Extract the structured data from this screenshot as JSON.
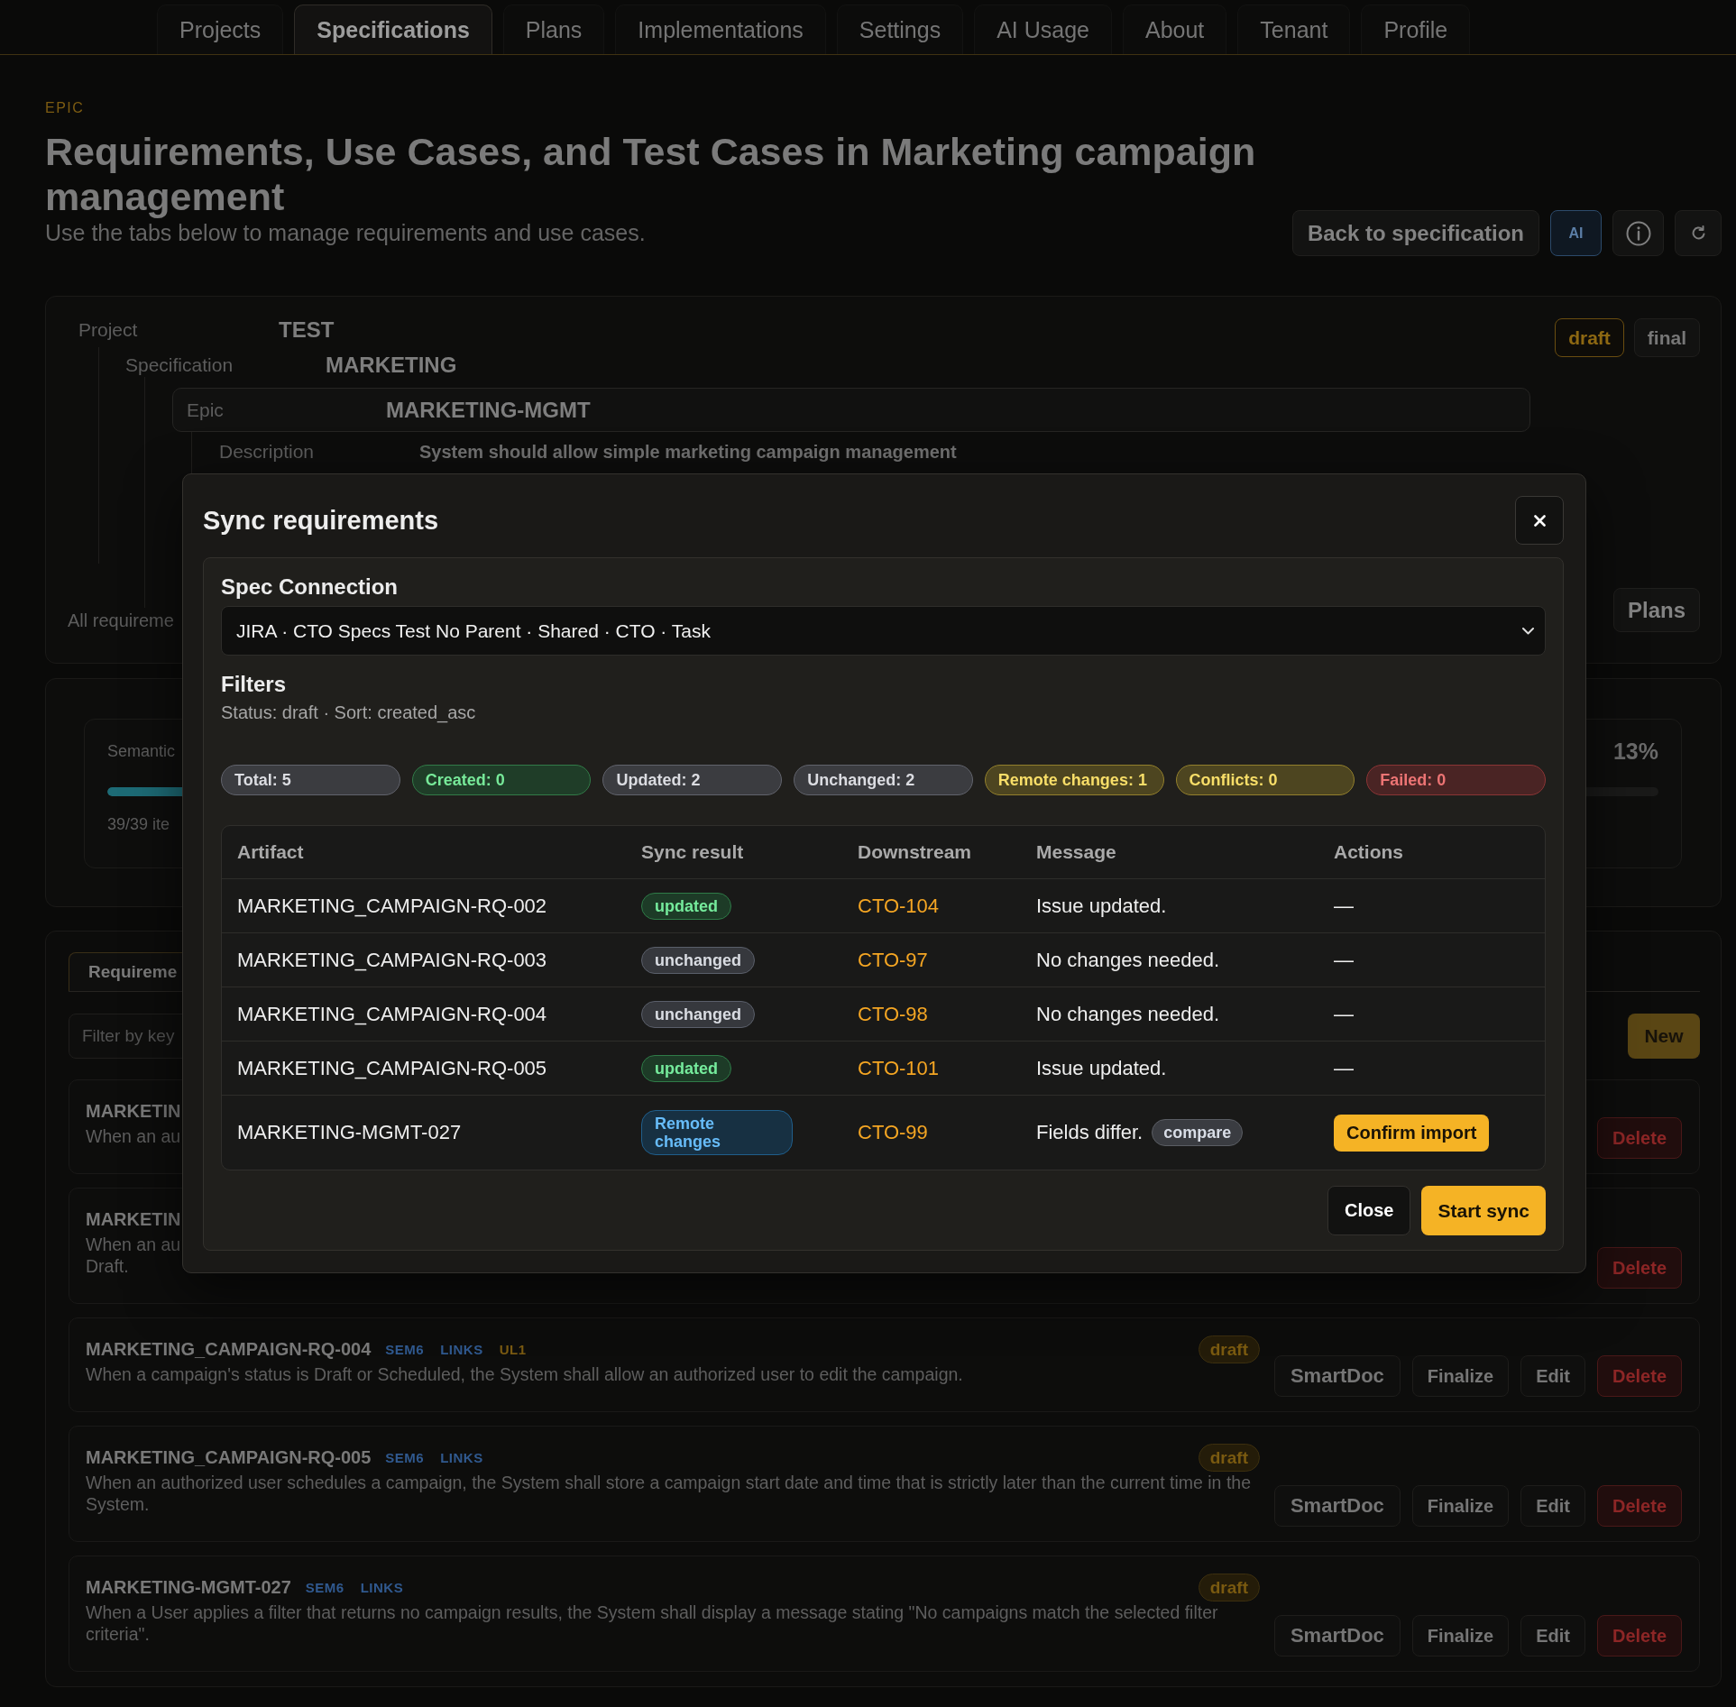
{
  "nav": {
    "tabs": [
      {
        "label": "Projects",
        "selected": false
      },
      {
        "label": "Specifications",
        "selected": true
      },
      {
        "label": "Plans",
        "selected": false
      },
      {
        "label": "Implementations",
        "selected": false
      },
      {
        "label": "Settings",
        "selected": false
      },
      {
        "label": "AI Usage",
        "selected": false
      },
      {
        "label": "About",
        "selected": false
      },
      {
        "label": "Tenant",
        "selected": false
      },
      {
        "label": "Profile",
        "selected": false
      }
    ]
  },
  "header": {
    "eyebrow": "EPIC",
    "title": "Requirements, Use Cases, and Test Cases in Marketing campaign management",
    "subtitle": "Use the tabs below to manage requirements and use cases.",
    "back_button": "Back to specification",
    "ai_button": "AI"
  },
  "hierarchy": {
    "project": {
      "label": "Project",
      "value": "TEST"
    },
    "specification": {
      "label": "Specification",
      "value": "MARKETING"
    },
    "epic": {
      "label": "Epic",
      "value": "MARKETING-MGMT"
    },
    "description": {
      "label": "Description",
      "value": "System should allow simple marketing campaign management"
    },
    "statuses": [
      {
        "label": "draft",
        "selected": true
      },
      {
        "label": "final",
        "selected": false
      }
    ],
    "footer_text": "All requireme",
    "plans_button": "Plans"
  },
  "coverage": {
    "label": "Semantic",
    "percent": "13%",
    "level": 0.13,
    "count": "39/39 ite"
  },
  "requirements": {
    "tabs": [
      {
        "label": "Requireme",
        "selected": true
      }
    ],
    "filter": {
      "placeholder": "Filter by key"
    },
    "new_button": "New",
    "items": [
      {
        "id": "MARKETIN",
        "description_lines": [
          "When an au"
        ],
        "buttons": [
          {
            "kind": "danger",
            "label": "Delete"
          }
        ]
      },
      {
        "id": "MARKETIN",
        "description_lines": [
          "When an au",
          "Draft."
        ],
        "buttons": [
          {
            "kind": "danger",
            "label": "Delete"
          }
        ]
      },
      {
        "id": "MARKETING_CAMPAIGN-RQ-004",
        "tags": [
          {
            "label": "SEM6",
            "color": "#30598f"
          },
          {
            "label": "LINKS",
            "color": "#30598f"
          },
          {
            "label": "UL1",
            "color": "#7a5a12"
          }
        ],
        "status": "draft",
        "description_lines": [
          "When a campaign's status is Draft or Scheduled, the System shall allow an authorized user to edit the campaign."
        ],
        "buttons": [
          {
            "kind": "large",
            "label": "SmartDoc"
          },
          {
            "kind": "plain",
            "label": "Finalize"
          },
          {
            "kind": "plain",
            "label": "Edit"
          },
          {
            "kind": "danger",
            "label": "Delete"
          }
        ]
      },
      {
        "id": "MARKETING_CAMPAIGN-RQ-005",
        "tags": [
          {
            "label": "SEM6",
            "color": "#30598f"
          },
          {
            "label": "LINKS",
            "color": "#30598f"
          }
        ],
        "status": "draft",
        "description_lines": [
          "When an authorized user schedules a campaign, the System shall store a campaign start date and time that is strictly later than the current time in the System."
        ],
        "buttons": [
          {
            "kind": "large",
            "label": "SmartDoc"
          },
          {
            "kind": "plain",
            "label": "Finalize"
          },
          {
            "kind": "plain",
            "label": "Edit"
          },
          {
            "kind": "danger",
            "label": "Delete"
          }
        ]
      },
      {
        "id": "MARKETING-MGMT-027",
        "tags": [
          {
            "label": "SEM6",
            "color": "#30598f"
          },
          {
            "label": "LINKS",
            "color": "#30598f"
          }
        ],
        "status": "draft",
        "description_lines": [
          "When a User applies a filter that returns no campaign results, the System shall display a message stating \"No campaigns match the selected filter criteria\"."
        ],
        "buttons": [
          {
            "kind": "large",
            "label": "SmartDoc"
          },
          {
            "kind": "plain",
            "label": "Finalize"
          },
          {
            "kind": "plain",
            "label": "Edit"
          },
          {
            "kind": "danger",
            "label": "Delete"
          }
        ]
      }
    ]
  },
  "modal": {
    "title": "Sync requirements",
    "connection": {
      "label": "Spec Connection",
      "value": "JIRA · CTO Specs Test No Parent · Shared · CTO · Task"
    },
    "filters": {
      "label": "Filters",
      "summary": "Status: draft · Sort: created_asc"
    },
    "counts": [
      {
        "label": "Total: 5",
        "color": "#3b3c40"
      },
      {
        "label": "Created: 0",
        "color": "#1f3d28"
      },
      {
        "label": "Updated: 2",
        "color": "#3b3c40"
      },
      {
        "label": "Unchanged: 2",
        "color": "#3b3c40"
      },
      {
        "label": "Remote changes: 1",
        "color": "#4d4520"
      },
      {
        "label": "Conflicts: 0",
        "color": "#4d4520"
      },
      {
        "label": "Failed: 0",
        "color": "#4a2424"
      }
    ],
    "table": {
      "columns": [
        "Artifact",
        "Sync result",
        "Downstream",
        "Message",
        "Actions"
      ],
      "rows": [
        {
          "artifact": "MARKETING_CAMPAIGN-RQ-002",
          "result": {
            "label": "updated",
            "color": "#1d3b27"
          },
          "downstream": "CTO-104",
          "message": "Issue updated.",
          "action": {
            "kind": "text",
            "label": "—"
          }
        },
        {
          "artifact": "MARKETING_CAMPAIGN-RQ-003",
          "result": {
            "label": "unchanged",
            "color": "#36383d"
          },
          "downstream": "CTO-97",
          "message": "No changes needed.",
          "action": {
            "kind": "text",
            "label": "—"
          }
        },
        {
          "artifact": "MARKETING_CAMPAIGN-RQ-004",
          "result": {
            "label": "unchanged",
            "color": "#36383d"
          },
          "downstream": "CTO-98",
          "message": "No changes needed.",
          "action": {
            "kind": "text",
            "label": "—"
          }
        },
        {
          "artifact": "MARKETING_CAMPAIGN-RQ-005",
          "result": {
            "label": "updated",
            "color": "#1d3b27"
          },
          "downstream": "CTO-101",
          "message": "Issue updated.",
          "action": {
            "kind": "text",
            "label": "—"
          }
        },
        {
          "artifact": "MARKETING-MGMT-027",
          "result": {
            "label": "Remote changes",
            "color": "#173042"
          },
          "downstream": "CTO-99",
          "message": "Fields differ.",
          "message_tag": "compare",
          "action": {
            "kind": "button",
            "label": "Confirm import"
          }
        }
      ]
    },
    "buttons": [
      {
        "kind": "secondary",
        "label": "Close"
      },
      {
        "kind": "primary",
        "label": "Start sync"
      }
    ]
  }
}
